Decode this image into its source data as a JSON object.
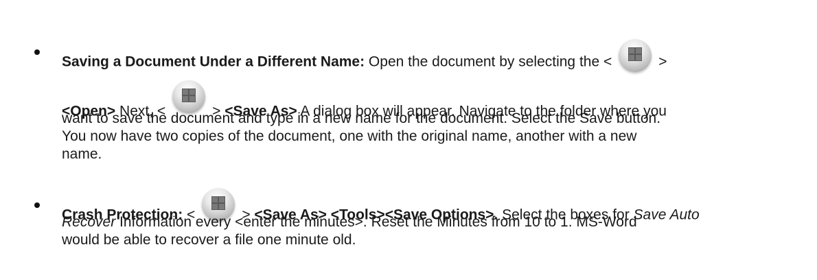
{
  "items": [
    {
      "bold_title": "Saving a Document Under a Different Name:",
      "t1": " Open the document by selecting the <",
      "t2": ">",
      "t3": "<Open>",
      "t4": " Next, <",
      "t5": "> ",
      "t6": "<Save As>",
      "t7": " A dialog box will appear. Navigate to the folder where you",
      "line3": "want to save the document and type in a new name for the document. Select the Save button.",
      "line4": "You now have two copies of the document, one with the original name, another with a new",
      "line5": "name."
    },
    {
      "bold_title": "Crash Protection:",
      "t1": " <",
      "t2": "> ",
      "t3": "<Save As> <Tools><Save Options>.",
      "t4": " Select the boxes for ",
      "t5": "Save Auto",
      "line2_italic": "Recover",
      "line2_rest": " Information every <enter the minutes>. Reset the Minutes from 10 to 1. MS-Word",
      "line3": "would be able to recover a file one minute old."
    }
  ],
  "icons": {
    "office_button": "office-button-icon"
  }
}
